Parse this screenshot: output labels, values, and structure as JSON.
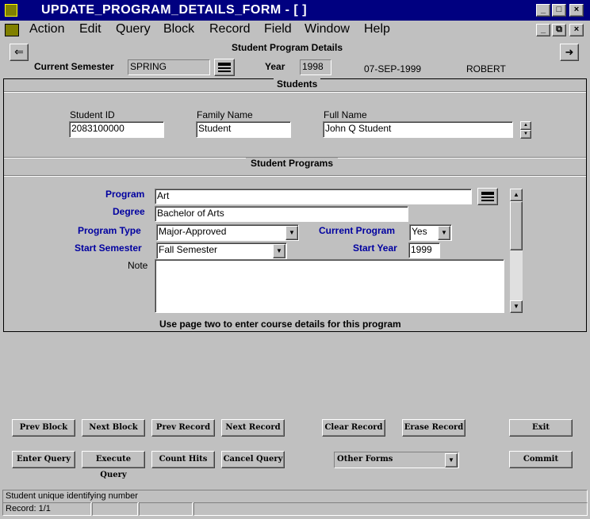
{
  "window": {
    "title": "UPDATE_PROGRAM_DETAILS_FORM - [ ]",
    "minimize": "_",
    "maximize": "□",
    "close": "×",
    "inner_minimize": "_",
    "inner_restore": "⧉",
    "inner_close": "×"
  },
  "menu": [
    "Action",
    "Edit",
    "Query",
    "Block",
    "Record",
    "Field",
    "Window",
    "Help"
  ],
  "header": {
    "back_arrow": "⇐",
    "forward_arrow": "➜",
    "form_title": "Student Program Details",
    "semester_label": "Current Semester",
    "semester_value": "SPRING",
    "year_label": "Year",
    "year_value": "1998",
    "date": "07-SEP-1999",
    "user": "ROBERT"
  },
  "students": {
    "section_title": "Students",
    "student_id_label": "Student ID",
    "student_id_value": "2083100000",
    "family_name_label": "Family Name",
    "family_name_value": "Student",
    "full_name_label": "Full Name",
    "full_name_value": "John Q Student"
  },
  "programs": {
    "section_title": "Student Programs",
    "program_label": "Program",
    "program_value": "Art",
    "degree_label": "Degree",
    "degree_value": "Bachelor of Arts",
    "program_type_label": "Program Type",
    "program_type_value": "Major-Approved",
    "current_program_label": "Current Program",
    "current_program_value": "Yes",
    "start_semester_label": "Start Semester",
    "start_semester_value": "Fall Semester",
    "start_year_label": "Start Year",
    "start_year_value": "1999",
    "note_label": "Note",
    "note_value": "",
    "hint": "Use page two to enter course details for this program"
  },
  "buttons": {
    "prev_block": "Prev Block",
    "next_block": "Next Block",
    "prev_record": "Prev Record",
    "next_record": "Next Record",
    "clear_record": "Clear Record",
    "erase_record": "Erase Record",
    "exit": "Exit",
    "enter_query": "Enter Query",
    "execute_query": "Execute Query",
    "count_hits": "Count Hits",
    "cancel_query": "Cancel Query",
    "other_forms": "Other Forms",
    "commit": "Commit"
  },
  "status": {
    "message": "Student unique identifying number",
    "record": "Record: 1/1"
  },
  "colors": {
    "titlebar": "#000080",
    "label_blue": "#0000a0",
    "face": "#c0c0c0"
  }
}
